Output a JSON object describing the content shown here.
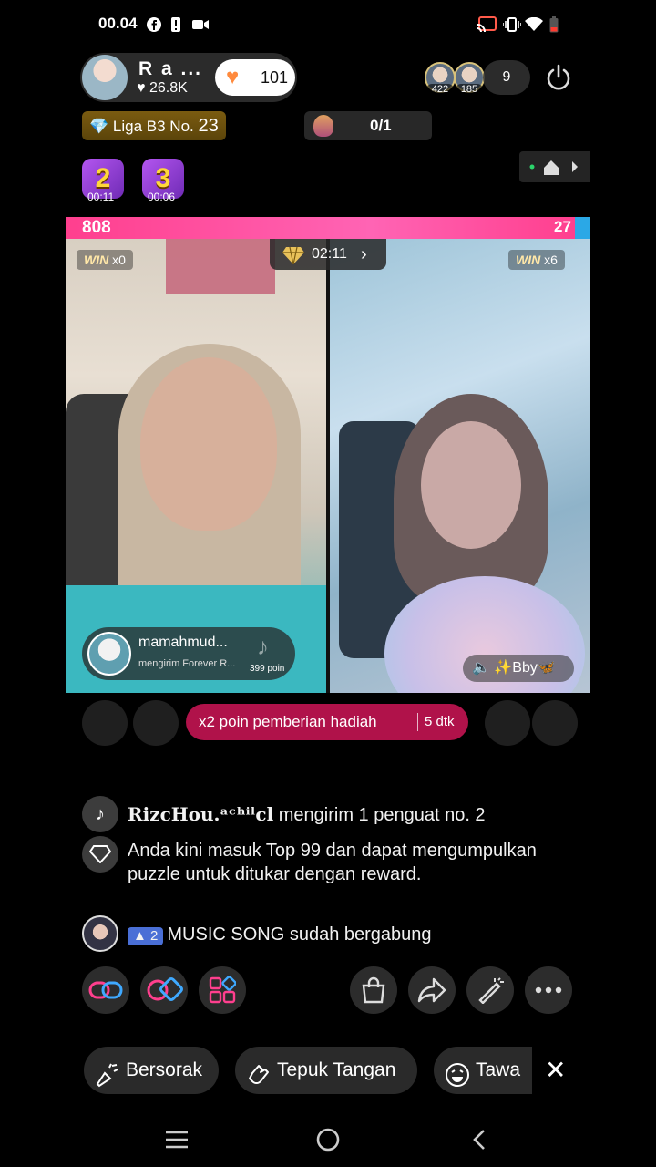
{
  "status_bar": {
    "time": "00.04",
    "icons": [
      "facebook-icon",
      "alert-icon",
      "camera-icon",
      "cast-icon",
      "vibrate-icon",
      "wifi-icon",
      "battery-low-icon"
    ],
    "battery_color": "#ff3b30"
  },
  "host": {
    "name": "R a ...",
    "likes": "26.8K",
    "gift_count": "101"
  },
  "viewers": {
    "top1_score": "422",
    "top2_score": "185",
    "count": "9"
  },
  "league": {
    "label": "Liga B3 No.",
    "number": "23"
  },
  "missions": {
    "progress": "0/1"
  },
  "badges": [
    {
      "rank": "2",
      "time": "00:11"
    },
    {
      "rank": "3",
      "time": "00:06"
    }
  ],
  "battle": {
    "left_score": "808",
    "right_score": "27",
    "left_win": "x0",
    "right_win": "x6",
    "win_label": "WIN",
    "timer": "02:11",
    "left_share": 0.97,
    "colors": {
      "left": "#ff3f8e",
      "right": "#2ba8e6"
    }
  },
  "gift_notice": {
    "user": "mamahmud...",
    "message": "mengirim Forever R...",
    "points": "399 poin"
  },
  "audio_tag": {
    "label": "✨Bby🦋"
  },
  "bonus_banner": {
    "text": "x2 poin pemberian hadiah",
    "timer": "5 dtk"
  },
  "chat": [
    {
      "icon": "tiktok-icon",
      "name": "RizcHou.ᵃᶜʰⁱˡcl",
      "text": " mengirim 1 penguat no. 2"
    },
    {
      "icon": "diamond-icon",
      "text": "Anda kini masuk Top 99 dan dapat mengumpulkan puzzle untuk ditukar dengan reward."
    },
    {
      "icon": "avatar",
      "level": "2",
      "text": "MUSIC SONG sudah bergabung"
    }
  ],
  "actions": [
    "link-icon",
    "multi-guest-icon",
    "apps-icon",
    "shopping-bag-icon",
    "share-icon",
    "magic-wand-icon",
    "more-icon"
  ],
  "reactions": [
    {
      "icon": "cheer-icon",
      "label": "Bersorak"
    },
    {
      "icon": "clap-icon",
      "label": "Tepuk Tangan"
    },
    {
      "icon": "laugh-icon",
      "label": "Tawa"
    }
  ],
  "nav": [
    "recents-icon",
    "home-icon",
    "back-icon"
  ]
}
